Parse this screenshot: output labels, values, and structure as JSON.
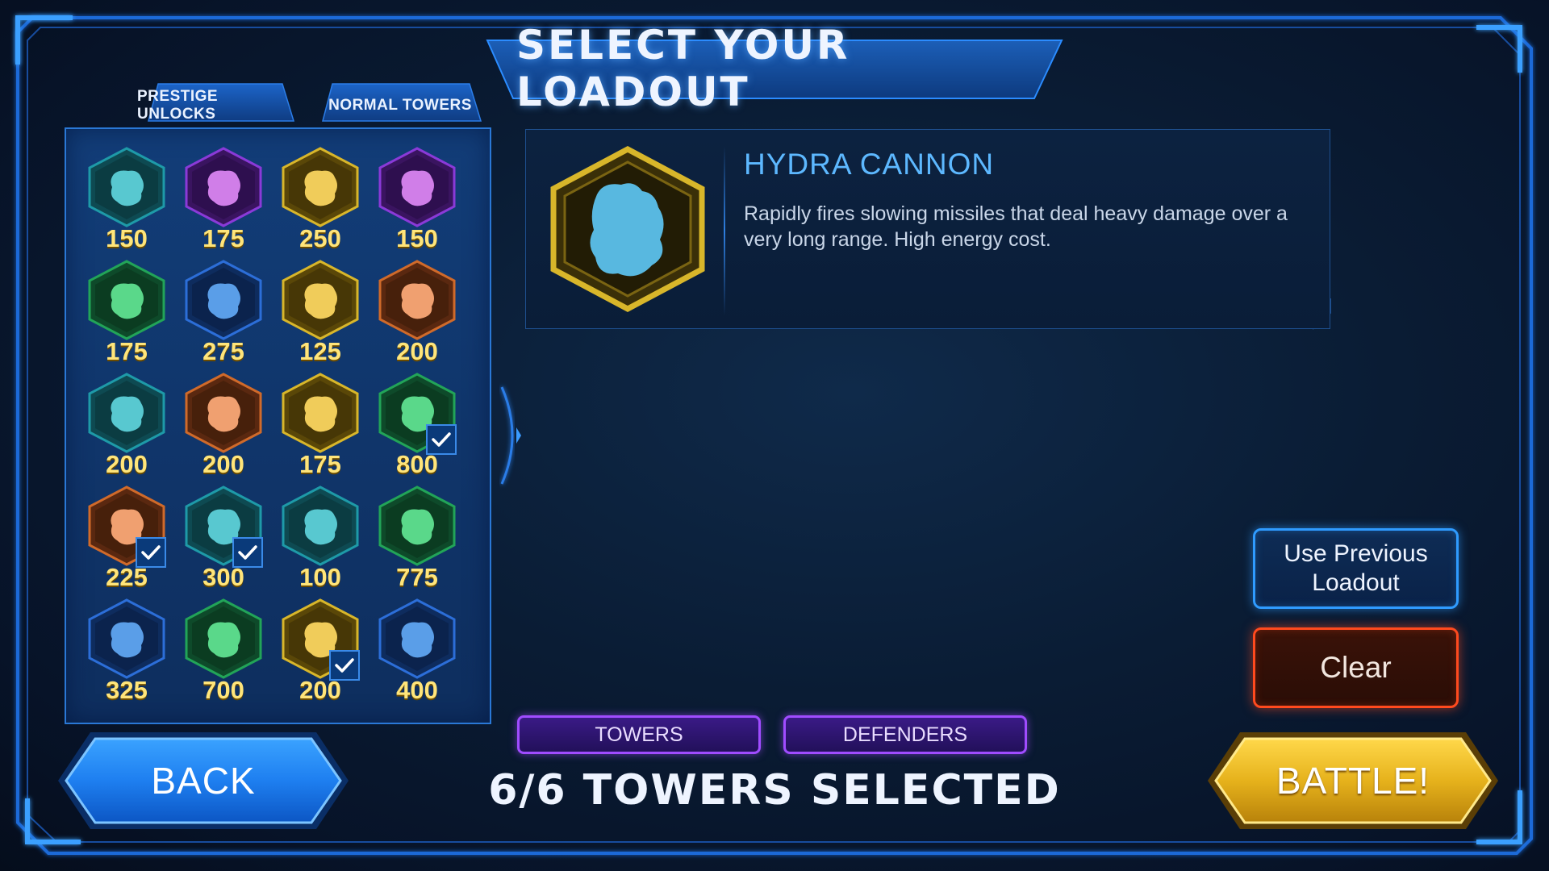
{
  "title": "SELECT YOUR LOADOUT",
  "tabs": {
    "prestige": "PRESTIGE UNLOCKS",
    "normal": "NORMAL TOWERS"
  },
  "selected_tower": {
    "name": "HYDRA CANNON",
    "description": "Rapidly fires slowing missiles that deal heavy damage over a very long range. High energy cost.",
    "icon": "hydra-cannon-icon",
    "frame_color": "#d8b62a",
    "icon_color": "#58b8e0"
  },
  "towers": [
    {
      "cost": "150",
      "color": "teal",
      "icon": "turret-icon",
      "checked": false
    },
    {
      "cost": "175",
      "color": "purple",
      "icon": "mortar-icon",
      "checked": false
    },
    {
      "cost": "250",
      "color": "gold",
      "icon": "cannon-icon",
      "checked": false
    },
    {
      "cost": "150",
      "color": "purple",
      "icon": "flask-icon",
      "checked": false
    },
    {
      "cost": "175",
      "color": "green",
      "icon": "artillery-icon",
      "checked": false
    },
    {
      "cost": "275",
      "color": "blue",
      "icon": "antenna-icon",
      "checked": false
    },
    {
      "cost": "125",
      "color": "gold",
      "icon": "pawn-icon",
      "checked": false
    },
    {
      "cost": "200",
      "color": "orange",
      "icon": "tank-icon",
      "checked": false
    },
    {
      "cost": "200",
      "color": "teal",
      "icon": "gatling-icon",
      "checked": false
    },
    {
      "cost": "200",
      "color": "orange",
      "icon": "blaster-icon",
      "checked": false
    },
    {
      "cost": "175",
      "color": "gold",
      "icon": "shield-icon",
      "checked": false
    },
    {
      "cost": "800",
      "color": "green",
      "icon": "mech-icon",
      "checked": true
    },
    {
      "cost": "225",
      "color": "orange",
      "icon": "tower-icon",
      "checked": true
    },
    {
      "cost": "300",
      "color": "teal",
      "icon": "laser-icon",
      "checked": true
    },
    {
      "cost": "100",
      "color": "teal",
      "icon": "blob-icon",
      "checked": false
    },
    {
      "cost": "775",
      "color": "green",
      "icon": "railgun-icon",
      "checked": false
    },
    {
      "cost": "325",
      "color": "blue",
      "icon": "beacon-icon",
      "checked": false
    },
    {
      "cost": "700",
      "color": "green",
      "icon": "beast-icon",
      "checked": false
    },
    {
      "cost": "200",
      "color": "gold",
      "icon": "hydra-cannon-icon",
      "checked": true
    },
    {
      "cost": "400",
      "color": "blue",
      "icon": "spire-icon",
      "checked": false
    }
  ],
  "buttons": {
    "use_previous": "Use Previous Loadout",
    "clear": "Clear",
    "towers": "TOWERS",
    "defenders": "DEFENDERS",
    "back": "BACK",
    "battle": "BATTLE!"
  },
  "status": "6/6 TOWERS SELECTED",
  "colors": {
    "accent_blue": "#2f9bff",
    "clear_red": "#ff4a1e",
    "pill_purple": "#a04cff",
    "battle_gold": "#e6b21c",
    "cost_yellow": "#ffe57a"
  }
}
